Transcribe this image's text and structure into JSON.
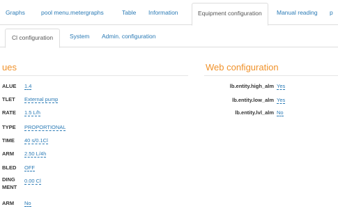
{
  "top_tabs": {
    "graphs": "Graphs",
    "pool_menu": "pool menu.metergraphs",
    "table": "Table",
    "information": "Information",
    "equipment": "Equipment configuration",
    "manual": "Manual reading",
    "more": "p"
  },
  "sub_tabs": {
    "cl_config": "Cl configuration",
    "system": "System",
    "admin": "Admin. configuration"
  },
  "left": {
    "heading": "ues",
    "rows": [
      {
        "label": "ALUE",
        "value": "1.4"
      },
      {
        "label": "TLET",
        "value": "External pump"
      },
      {
        "label": "RATE",
        "value": "1.5 L/h"
      },
      {
        "label": "TYPE",
        "value": "PROPORTIONAL"
      },
      {
        "label": "TIME",
        "value": "40 s/0.1Cl"
      },
      {
        "label": "ARM",
        "value": "2.50 L/4h"
      },
      {
        "label": "BLED",
        "value": "OFF"
      },
      {
        "label": "DING",
        "label2": "MENT",
        "value": "0.00 Cl"
      },
      {
        "label": "ARM",
        "value": "No"
      }
    ]
  },
  "right": {
    "heading": "Web configuration",
    "rows": [
      {
        "label": "lb.entity.high_alm",
        "value": "Yes"
      },
      {
        "label": "lb.entity.low_alm",
        "value": "Yes"
      },
      {
        "label": "lb.entity.lvl_alm",
        "value": "No"
      }
    ]
  }
}
